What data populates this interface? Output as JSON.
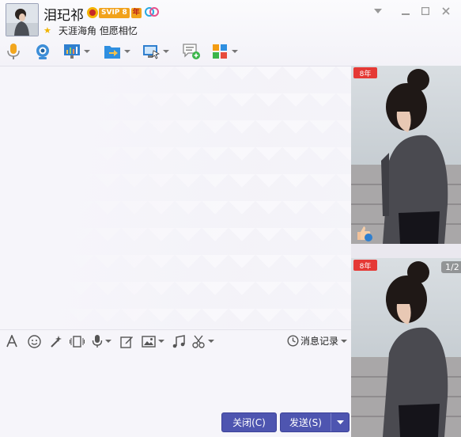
{
  "contact": {
    "name": "泪玘祁",
    "vip_label": "SVIP 8",
    "vip_year_label": "年",
    "signature": "天涯海角 但愿相忆"
  },
  "history": {
    "label": "消息记录"
  },
  "buttons": {
    "close": "关闭(C)",
    "send": "发送(S)"
  },
  "side_panel": {
    "page_indicator": "1/2"
  },
  "colors": {
    "accent": "#4e55b0",
    "vip": "#f1a21b"
  }
}
